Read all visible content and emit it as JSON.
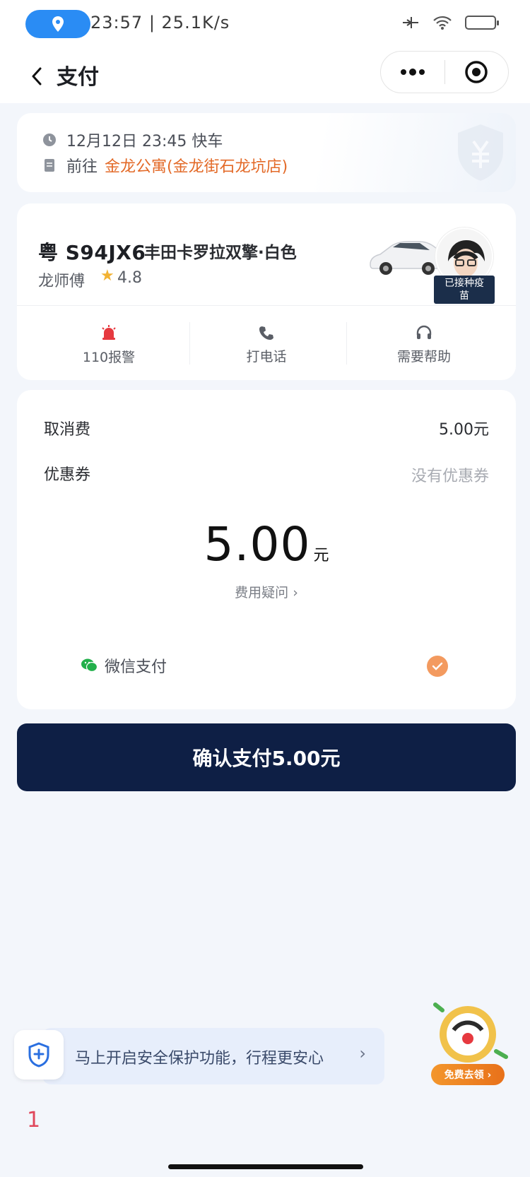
{
  "status_bar": {
    "time": "23:57",
    "speed": "25.1K/s"
  },
  "nav": {
    "title": "支付",
    "icons": [
      "back-icon",
      "more-icon",
      "target-icon"
    ]
  },
  "trip": {
    "datetime": "12月12日 23:45 快车",
    "to_prefix": "前往",
    "destination": "金龙公寓(金龙街石龙坑店)"
  },
  "driver": {
    "plate": "粤 S94JX6",
    "car_model": "丰田卡罗拉双擎·白色",
    "name": "龙师傅",
    "rating": "4.8",
    "vaccine_badge_line1": "已接种疫",
    "vaccine_badge_line2": "苗",
    "actions": [
      {
        "label": "110报警",
        "icon": "alarm-icon"
      },
      {
        "label": "打电话",
        "icon": "phone-icon"
      },
      {
        "label": "需要帮助",
        "icon": "headset-icon"
      }
    ]
  },
  "payment": {
    "cancel_fee_label": "取消费",
    "cancel_fee_value": "5.00元",
    "coupon_label": "优惠券",
    "coupon_value": "没有优惠券",
    "amount": "5.00",
    "amount_unit": "元",
    "fee_question": "费用疑问 ›",
    "method_label": "微信支付"
  },
  "confirm_button": "确认支付5.00元",
  "safety": {
    "text": "马上开启安全保护功能，行程更安心",
    "arrow": "›"
  },
  "promo": {
    "label": "免费去领 ›"
  },
  "page_number": "1",
  "colors": {
    "accent_orange": "#e36a28",
    "confirm_bg": "#0e1f45",
    "check_orange": "#f39a5f",
    "wechat_green": "#22b04b"
  }
}
